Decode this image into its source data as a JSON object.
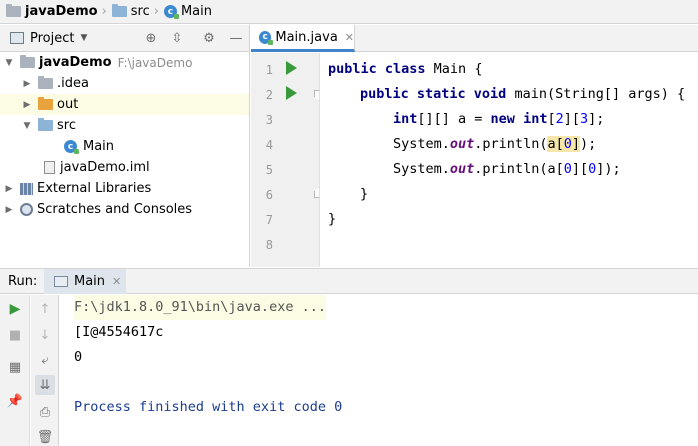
{
  "breadcrumb": {
    "project": "javaDemo",
    "folder": "src",
    "file": "Main"
  },
  "project_panel": {
    "title": "Project",
    "tree": [
      {
        "label": "javaDemo",
        "hint": "F:\\javaDemo",
        "icon": "folder-icon"
      },
      {
        "label": ".idea",
        "icon": "folder-icon"
      },
      {
        "label": "out",
        "icon": "folder-icon"
      },
      {
        "label": "src",
        "icon": "folder-icon"
      },
      {
        "label": "Main",
        "icon": "java-class-icon"
      },
      {
        "label": "javaDemo.iml",
        "icon": "module-file-icon"
      },
      {
        "label": "External Libraries",
        "icon": "library-icon"
      },
      {
        "label": "Scratches and Consoles",
        "icon": "scratches-icon"
      }
    ]
  },
  "editor": {
    "tab_label": "Main.java",
    "line_numbers": [
      "1",
      "2",
      "3",
      "4",
      "5",
      "6",
      "7",
      "8"
    ],
    "lines": {
      "l1": {
        "kw": "public class",
        "rest": " Main {"
      },
      "l2": {
        "kw": "public static void",
        "rest": " main(String[] args) {"
      },
      "l3": {
        "kw1": "int",
        "mid1": "[][] a = ",
        "kw2": "new",
        "sp": " ",
        "kw3": "int",
        "n1a": "[",
        "n1": "2",
        "n1b": "][",
        "n2": "3",
        "n2b": "];"
      },
      "l4": {
        "pre": "System.",
        "fld": "out",
        "post": ".println(",
        "b1": "a[",
        "idx": "0",
        "b2": "]",
        "end": ");"
      },
      "l5": {
        "pre": "System.",
        "fld": "out",
        "post": ".println(a[",
        "i1": "0",
        "mid": "][",
        "i2": "0",
        "end": "]);"
      },
      "l6": "}",
      "l7": "}"
    }
  },
  "run_panel": {
    "label": "Run:",
    "tab_label": "Main",
    "output": [
      "F:\\jdk1.8.0_91\\bin\\java.exe ...",
      "[I@4554617c",
      "0",
      "",
      "Process finished with exit code 0"
    ]
  },
  "colors": {
    "keyword": "#000080",
    "static_field": "#660e7a",
    "number": "#0000ff",
    "run_green": "#389a3a",
    "selection_tab": "#4083c9"
  }
}
